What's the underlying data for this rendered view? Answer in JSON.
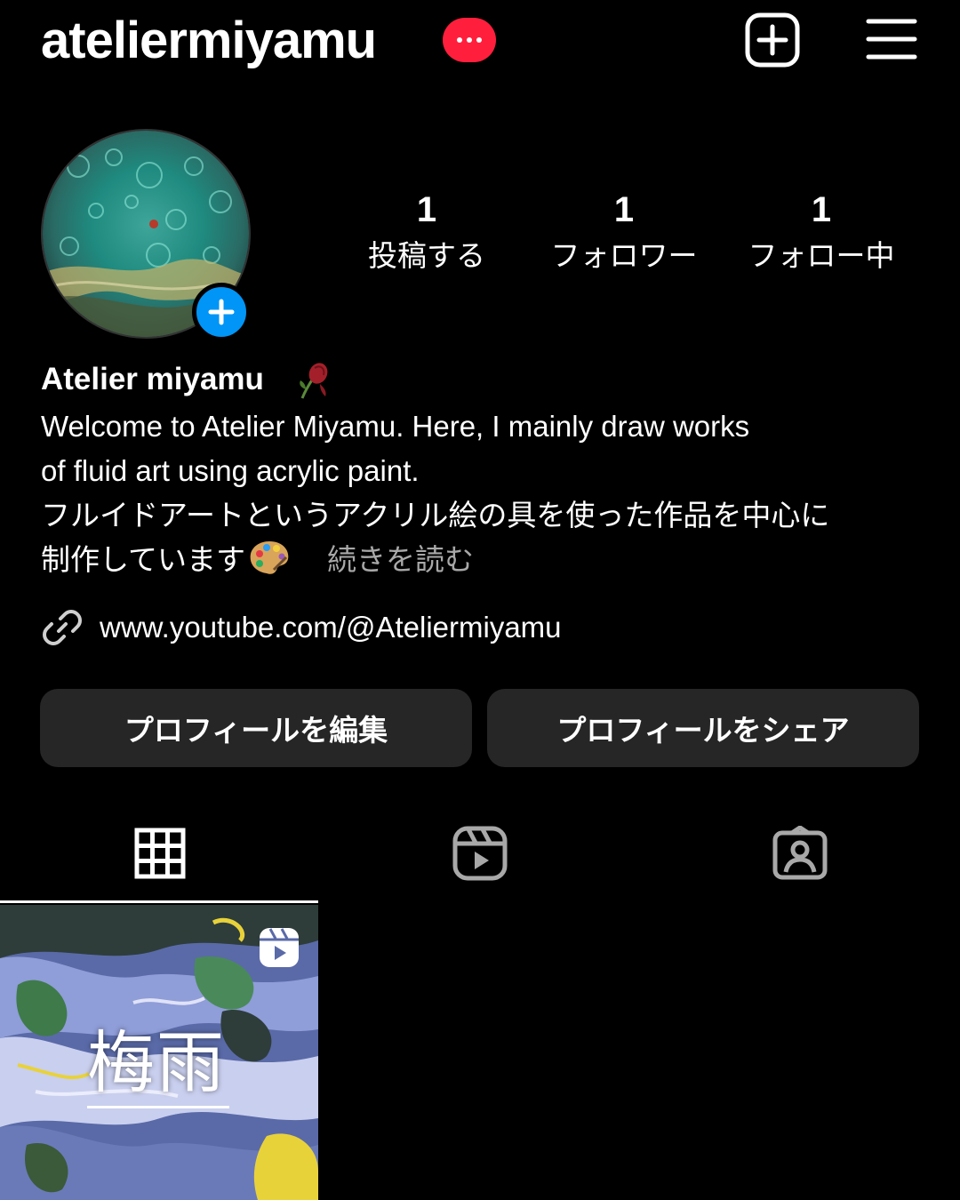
{
  "header": {
    "username": "ateliermiyamu",
    "badge_icon": "more-dots-icon",
    "create_icon": "plus-square-icon",
    "menu_icon": "hamburger-menu-icon",
    "badge_color": "#ff1f3d"
  },
  "profile": {
    "avatar_icon": "fluid-art-avatar",
    "add_story_icon": "plus-icon",
    "accent_color": "#0095f6"
  },
  "stats": {
    "posts": {
      "value": "1",
      "label": "投稿する"
    },
    "followers": {
      "value": "1",
      "label": "フォロワー"
    },
    "following": {
      "value": "1",
      "label": "フォロー中"
    }
  },
  "bio": {
    "display_name": "Atelier miyamu",
    "name_emoji": "wilted-rose-icon",
    "line1": "Welcome to Atelier Miyamu. Here, I mainly draw works",
    "line2": "of fluid art using acrylic paint.",
    "line3": "フルイドアートというアクリル絵の具を使った作品を中心に",
    "line4": "制作しています",
    "line4_emoji": "artist-palette-icon",
    "read_more": "続きを読む",
    "link": "www.youtube.com/@Ateliermiyamu",
    "link_icon": "link-icon",
    "muted_color": "#a8a8a8"
  },
  "buttons": {
    "edit_profile": "プロフィールを編集",
    "share_profile": "プロフィールをシェア"
  },
  "tabs": {
    "grid_icon": "grid-icon",
    "reels_icon": "reels-icon",
    "tagged_icon": "tagged-person-icon"
  },
  "posts": [
    {
      "title": "梅雨",
      "type_icon": "reels-icon"
    }
  ]
}
